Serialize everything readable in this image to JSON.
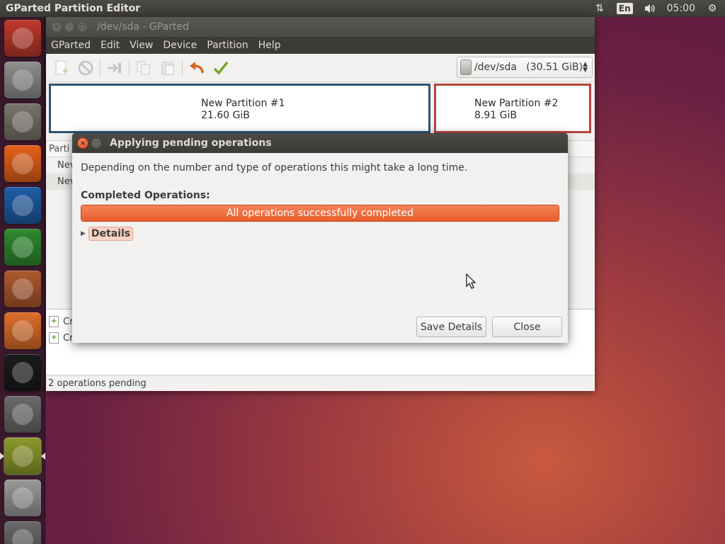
{
  "top_panel": {
    "app_title": "GParted Partition Editor",
    "keyboard_layout": "En",
    "clock": "05:00"
  },
  "launcher": {
    "items": [
      {
        "name": "dash-home-icon",
        "color": "#c0392b"
      },
      {
        "name": "gparted-installer-icon",
        "color": "#8f8f8f"
      },
      {
        "name": "files-icon",
        "color": "#7a756c"
      },
      {
        "name": "firefox-icon",
        "color": "#e8621b"
      },
      {
        "name": "writer-icon",
        "color": "#1f5ea8"
      },
      {
        "name": "calc-icon",
        "color": "#2e8b2e"
      },
      {
        "name": "impress-icon",
        "color": "#b05a2e"
      },
      {
        "name": "software-center-icon",
        "color": "#e0702a"
      },
      {
        "name": "amazon-icon",
        "color": "#1b1b1b"
      },
      {
        "name": "system-settings-icon",
        "color": "#6b6b6b"
      },
      {
        "name": "gparted-icon",
        "color": "#8d9a2a"
      },
      {
        "name": "disk-icon",
        "color": "#9a9a9a"
      },
      {
        "name": "trash-icon",
        "color": "#6a6a6a"
      }
    ]
  },
  "main_window": {
    "title": "/dev/sda - GParted",
    "menu": [
      "GParted",
      "Edit",
      "View",
      "Device",
      "Partition",
      "Help"
    ],
    "device_selector": "/dev/sda   (30.51 GiB)",
    "partitions": [
      {
        "name": "New Partition #1",
        "size": "21.60 GiB",
        "color": "#2b5473"
      },
      {
        "name": "New Partition #2",
        "size": "8.91 GiB",
        "color": "#b5433c"
      }
    ],
    "table_header": "Parti",
    "table_rows": [
      "Nev",
      "Nev"
    ],
    "ops": [
      "Cr",
      "Cr"
    ],
    "status": "2 operations pending"
  },
  "dialog": {
    "title": "Applying pending operations",
    "description": "Depending on the number and type of operations this might take a long time.",
    "completed_label": "Completed Operations:",
    "progress_text": "All operations successfully completed",
    "progress_fraction": 1.0,
    "details_label": "Details",
    "save_details_label": "Save Details",
    "close_label": "Close"
  }
}
